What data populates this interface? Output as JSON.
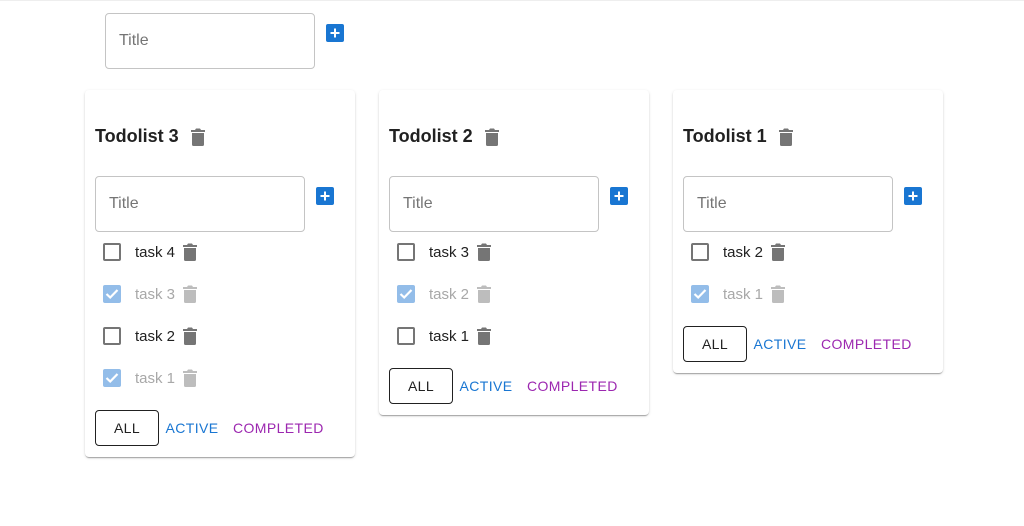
{
  "new_list": {
    "placeholder": "Title"
  },
  "todolists": [
    {
      "title": "Todolist 3",
      "input_placeholder": "Title",
      "tasks": [
        {
          "label": "task 4",
          "done": false
        },
        {
          "label": "task 3",
          "done": true
        },
        {
          "label": "task 2",
          "done": false
        },
        {
          "label": "task 1",
          "done": true
        }
      ],
      "filters": {
        "all": "ALL",
        "active": "ACTIVE",
        "completed": "COMPLETED"
      }
    },
    {
      "title": "Todolist 2",
      "input_placeholder": "Title",
      "tasks": [
        {
          "label": "task 3",
          "done": false
        },
        {
          "label": "task 2",
          "done": true
        },
        {
          "label": "task 1",
          "done": false
        }
      ],
      "filters": {
        "all": "ALL",
        "active": "ACTIVE",
        "completed": "COMPLETED"
      }
    },
    {
      "title": "Todolist 1",
      "input_placeholder": "Title",
      "tasks": [
        {
          "label": "task 2",
          "done": false
        },
        {
          "label": "task 1",
          "done": true
        }
      ],
      "filters": {
        "all": "ALL",
        "active": "ACTIVE",
        "completed": "COMPLETED"
      }
    }
  ],
  "icons": {
    "add": "plus-box-icon",
    "delete": "trash-icon",
    "check": "checkmark-icon"
  },
  "colors": {
    "primary": "#1976d2",
    "secondary": "#9c27b0",
    "checked": "#93bde9",
    "icon_gray": "#757575"
  }
}
